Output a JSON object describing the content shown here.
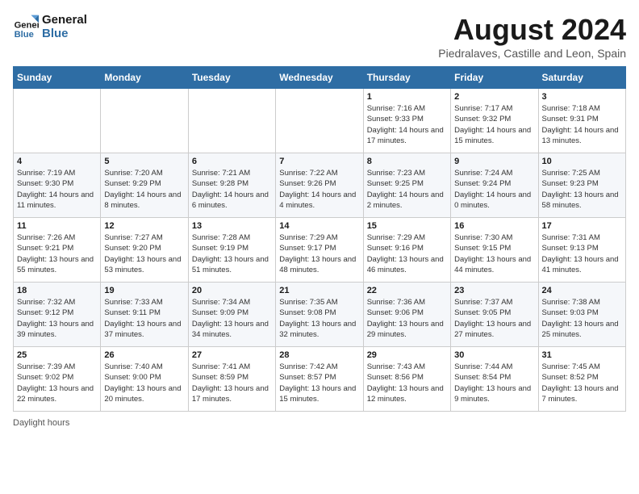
{
  "header": {
    "logo_line1": "General",
    "logo_line2": "Blue",
    "title": "August 2024",
    "subtitle": "Piedralaves, Castille and Leon, Spain"
  },
  "days_of_week": [
    "Sunday",
    "Monday",
    "Tuesday",
    "Wednesday",
    "Thursday",
    "Friday",
    "Saturday"
  ],
  "weeks": [
    [
      {
        "day": "",
        "info": ""
      },
      {
        "day": "",
        "info": ""
      },
      {
        "day": "",
        "info": ""
      },
      {
        "day": "",
        "info": ""
      },
      {
        "day": "1",
        "info": "Sunrise: 7:16 AM\nSunset: 9:33 PM\nDaylight: 14 hours and 17 minutes."
      },
      {
        "day": "2",
        "info": "Sunrise: 7:17 AM\nSunset: 9:32 PM\nDaylight: 14 hours and 15 minutes."
      },
      {
        "day": "3",
        "info": "Sunrise: 7:18 AM\nSunset: 9:31 PM\nDaylight: 14 hours and 13 minutes."
      }
    ],
    [
      {
        "day": "4",
        "info": "Sunrise: 7:19 AM\nSunset: 9:30 PM\nDaylight: 14 hours and 11 minutes."
      },
      {
        "day": "5",
        "info": "Sunrise: 7:20 AM\nSunset: 9:29 PM\nDaylight: 14 hours and 8 minutes."
      },
      {
        "day": "6",
        "info": "Sunrise: 7:21 AM\nSunset: 9:28 PM\nDaylight: 14 hours and 6 minutes."
      },
      {
        "day": "7",
        "info": "Sunrise: 7:22 AM\nSunset: 9:26 PM\nDaylight: 14 hours and 4 minutes."
      },
      {
        "day": "8",
        "info": "Sunrise: 7:23 AM\nSunset: 9:25 PM\nDaylight: 14 hours and 2 minutes."
      },
      {
        "day": "9",
        "info": "Sunrise: 7:24 AM\nSunset: 9:24 PM\nDaylight: 14 hours and 0 minutes."
      },
      {
        "day": "10",
        "info": "Sunrise: 7:25 AM\nSunset: 9:23 PM\nDaylight: 13 hours and 58 minutes."
      }
    ],
    [
      {
        "day": "11",
        "info": "Sunrise: 7:26 AM\nSunset: 9:21 PM\nDaylight: 13 hours and 55 minutes."
      },
      {
        "day": "12",
        "info": "Sunrise: 7:27 AM\nSunset: 9:20 PM\nDaylight: 13 hours and 53 minutes."
      },
      {
        "day": "13",
        "info": "Sunrise: 7:28 AM\nSunset: 9:19 PM\nDaylight: 13 hours and 51 minutes."
      },
      {
        "day": "14",
        "info": "Sunrise: 7:29 AM\nSunset: 9:17 PM\nDaylight: 13 hours and 48 minutes."
      },
      {
        "day": "15",
        "info": "Sunrise: 7:29 AM\nSunset: 9:16 PM\nDaylight: 13 hours and 46 minutes."
      },
      {
        "day": "16",
        "info": "Sunrise: 7:30 AM\nSunset: 9:15 PM\nDaylight: 13 hours and 44 minutes."
      },
      {
        "day": "17",
        "info": "Sunrise: 7:31 AM\nSunset: 9:13 PM\nDaylight: 13 hours and 41 minutes."
      }
    ],
    [
      {
        "day": "18",
        "info": "Sunrise: 7:32 AM\nSunset: 9:12 PM\nDaylight: 13 hours and 39 minutes."
      },
      {
        "day": "19",
        "info": "Sunrise: 7:33 AM\nSunset: 9:11 PM\nDaylight: 13 hours and 37 minutes."
      },
      {
        "day": "20",
        "info": "Sunrise: 7:34 AM\nSunset: 9:09 PM\nDaylight: 13 hours and 34 minutes."
      },
      {
        "day": "21",
        "info": "Sunrise: 7:35 AM\nSunset: 9:08 PM\nDaylight: 13 hours and 32 minutes."
      },
      {
        "day": "22",
        "info": "Sunrise: 7:36 AM\nSunset: 9:06 PM\nDaylight: 13 hours and 29 minutes."
      },
      {
        "day": "23",
        "info": "Sunrise: 7:37 AM\nSunset: 9:05 PM\nDaylight: 13 hours and 27 minutes."
      },
      {
        "day": "24",
        "info": "Sunrise: 7:38 AM\nSunset: 9:03 PM\nDaylight: 13 hours and 25 minutes."
      }
    ],
    [
      {
        "day": "25",
        "info": "Sunrise: 7:39 AM\nSunset: 9:02 PM\nDaylight: 13 hours and 22 minutes."
      },
      {
        "day": "26",
        "info": "Sunrise: 7:40 AM\nSunset: 9:00 PM\nDaylight: 13 hours and 20 minutes."
      },
      {
        "day": "27",
        "info": "Sunrise: 7:41 AM\nSunset: 8:59 PM\nDaylight: 13 hours and 17 minutes."
      },
      {
        "day": "28",
        "info": "Sunrise: 7:42 AM\nSunset: 8:57 PM\nDaylight: 13 hours and 15 minutes."
      },
      {
        "day": "29",
        "info": "Sunrise: 7:43 AM\nSunset: 8:56 PM\nDaylight: 13 hours and 12 minutes."
      },
      {
        "day": "30",
        "info": "Sunrise: 7:44 AM\nSunset: 8:54 PM\nDaylight: 13 hours and 9 minutes."
      },
      {
        "day": "31",
        "info": "Sunrise: 7:45 AM\nSunset: 8:52 PM\nDaylight: 13 hours and 7 minutes."
      }
    ]
  ],
  "footer": "Daylight hours"
}
